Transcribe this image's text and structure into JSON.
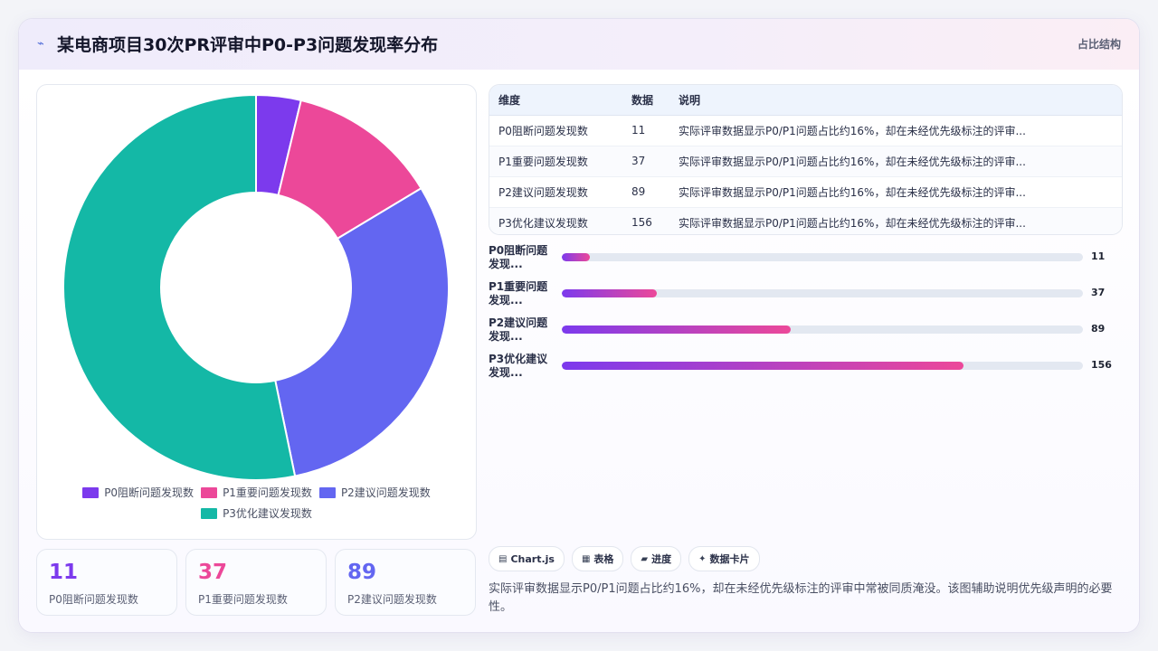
{
  "header": {
    "title": "某电商项目30次PR评审中P0-P3问题发现率分布",
    "tag": "占比结构"
  },
  "chart_data": {
    "type": "pie",
    "variant": "doughnut",
    "categories": [
      "P0阻断问题发现数",
      "P1重要问题发现数",
      "P2建议问题发现数",
      "P3优化建议发现数"
    ],
    "values": [
      11,
      37,
      89,
      156
    ],
    "colors": [
      "#7c3aed",
      "#ec4899",
      "#6366f1",
      "#14b8a6"
    ],
    "legend": "bottom"
  },
  "table": {
    "headers": [
      "维度",
      "数据",
      "说明"
    ],
    "rows": [
      [
        "P0阻断问题发现数",
        "11",
        "实际评审数据显示P0/P1问题占比约16%，却在未经优先级标注的评审..."
      ],
      [
        "P1重要问题发现数",
        "37",
        "实际评审数据显示P0/P1问题占比约16%，却在未经优先级标注的评审..."
      ],
      [
        "P2建议问题发现数",
        "89",
        "实际评审数据显示P0/P1问题占比约16%，却在未经优先级标注的评审..."
      ],
      [
        "P3优化建议发现数",
        "156",
        "实际评审数据显示P0/P1问题占比约16%，却在未经优先级标注的评审..."
      ]
    ]
  },
  "progress": {
    "max": 156,
    "items": [
      {
        "label": "P0阻断问题\n发现...",
        "value": 11
      },
      {
        "label": "P1重要问题\n发现...",
        "value": 37
      },
      {
        "label": "P2建议问题\n发现...",
        "value": 89
      },
      {
        "label": "P3优化建议\n发现...",
        "value": 156
      }
    ]
  },
  "stats": [
    {
      "value": "11",
      "label": "P0阻断问题发现数",
      "color": "#7c3aed"
    },
    {
      "value": "37",
      "label": "P1重要问题发现数",
      "color": "#ec4899"
    },
    {
      "value": "89",
      "label": "P2建议问题发现数",
      "color": "#6366f1"
    }
  ],
  "chips": [
    {
      "icon": "chart-icon",
      "label": "Chart.js"
    },
    {
      "icon": "table-icon",
      "label": "表格"
    },
    {
      "icon": "progress-icon",
      "label": "进度"
    },
    {
      "icon": "sparkle-icon",
      "label": "数据卡片"
    }
  ],
  "note": "实际评审数据显示P0/P1问题占比约16%，却在未经优先级标注的评审中常被同质淹没。该图辅助说明优先级声明的必要性。"
}
